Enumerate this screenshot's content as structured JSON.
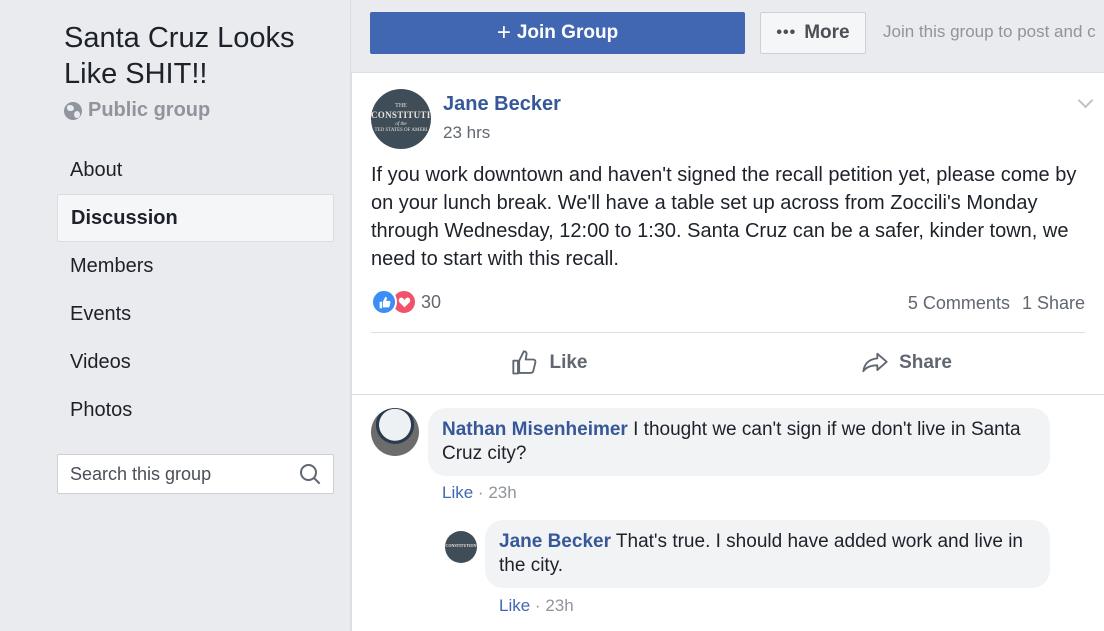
{
  "group": {
    "title": "Santa Cruz Looks Like SHIT!!",
    "privacy": "Public group"
  },
  "nav": {
    "items": [
      {
        "label": "About"
      },
      {
        "label": "Discussion"
      },
      {
        "label": "Members"
      },
      {
        "label": "Events"
      },
      {
        "label": "Videos"
      },
      {
        "label": "Photos"
      }
    ],
    "active": "Discussion"
  },
  "search": {
    "placeholder": "Search this group"
  },
  "actions": {
    "join_label": "Join Group",
    "more_label": "More",
    "join_hint": "Join this group to post and c"
  },
  "post": {
    "author": "Jane Becker",
    "time": "23 hrs",
    "avatar_text": {
      "line1": "THE",
      "line2": "CONSTITUTION",
      "line3": "of the",
      "line4": "TED STATES OF AMERI"
    },
    "text": "If you work downtown and haven't signed the recall petition yet, please come by on your lunch break. We'll have a table set up across from Zoccili's Monday through Wednesday, 12:00 to 1:30. Santa Cruz can be a safer, kinder town, we need to start with this recall.",
    "reaction_count": "30",
    "comments_count": "5 Comments",
    "shares_count": "1 Share",
    "like_label": "Like",
    "share_label": "Share"
  },
  "comments": [
    {
      "author": "Nathan Misenheimer",
      "text": "I thought we can't sign if we don't live in Santa Cruz city?",
      "like": "Like",
      "time": "23h"
    },
    {
      "author": "Jane Becker",
      "text": "That's true. I should have added work and live in the city.",
      "like": "Like",
      "time": "23h"
    }
  ],
  "colors": {
    "brand": "#4267b2",
    "link": "#365899",
    "background": "#e9ebee"
  }
}
